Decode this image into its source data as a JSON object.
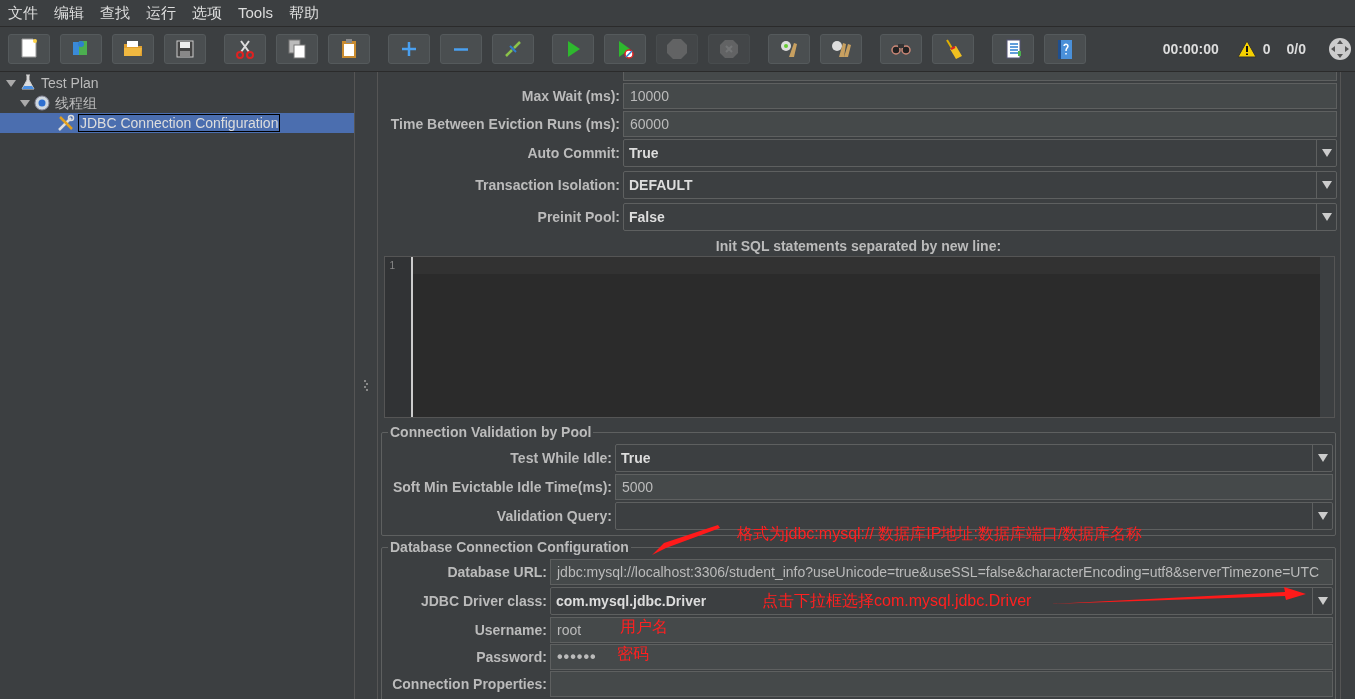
{
  "menu": [
    {
      "label": "文件"
    },
    {
      "label": "编辑"
    },
    {
      "label": "查找"
    },
    {
      "label": "运行"
    },
    {
      "label": "选项"
    },
    {
      "label": "Tools"
    },
    {
      "label": "帮助"
    }
  ],
  "toolbar": {
    "buttons": [
      {
        "disabled": false
      },
      {
        "disabled": false
      },
      {
        "disabled": false
      },
      {
        "disabled": false
      },
      {
        "disabled": false
      },
      {
        "disabled": false
      },
      {
        "disabled": false
      },
      {
        "disabled": false
      },
      {
        "disabled": false
      },
      {
        "disabled": false
      },
      {
        "disabled": false
      },
      {
        "disabled": false
      },
      {
        "disabled": true
      },
      {
        "disabled": true
      },
      {
        "disabled": false
      },
      {
        "disabled": false
      },
      {
        "disabled": false
      },
      {
        "disabled": false
      },
      {
        "disabled": false
      },
      {
        "disabled": false
      }
    ],
    "timer": "00:00:00",
    "warnings": "0",
    "threads": "0/0"
  },
  "tree": [
    {
      "label": "Test Plan",
      "kind": "test-plan",
      "selected": false,
      "expanded": true,
      "children": [
        {
          "label": "线程组",
          "kind": "thread-group",
          "selected": false,
          "expanded": true,
          "children": [
            {
              "label": "JDBC Connection Configuration",
              "kind": "config",
              "selected": true
            }
          ]
        }
      ]
    }
  ],
  "pool_fields": [
    {
      "kind": "text"
    },
    {
      "label": "Max Wait (ms):",
      "kind": "text",
      "value": "10000"
    },
    {
      "label": "Time Between Eviction Runs (ms):",
      "kind": "text",
      "value": "60000"
    },
    {
      "label": "Auto Commit:",
      "kind": "combo",
      "value": "True"
    },
    {
      "label": "Transaction Isolation:",
      "kind": "combo",
      "value": "DEFAULT"
    },
    {
      "label": "Preinit Pool:",
      "kind": "combo",
      "value": "False"
    }
  ],
  "init_sql": {
    "heading": "Init SQL statements separated by new line:",
    "line_numbers": [
      "1"
    ]
  },
  "validation": {
    "legend": "Connection Validation by Pool",
    "fields": [
      {
        "label": "Test While Idle:",
        "kind": "combo",
        "value": "True"
      },
      {
        "label": "Soft Min Evictable Idle Time(ms):",
        "kind": "text",
        "value": "5000"
      },
      {
        "label": "Validation Query:",
        "kind": "combo"
      }
    ]
  },
  "database": {
    "legend": "Database Connection Configuration",
    "fields": [
      {
        "label": "Database URL:",
        "kind": "text",
        "value": "jdbc:mysql://localhost:3306/student_info?useUnicode=true&useSSL=false&characterEncoding=utf8&serverTimezone=UTC"
      },
      {
        "label": "JDBC Driver class:",
        "kind": "combo",
        "value": "com.mysql.jdbc.Driver"
      },
      {
        "label": "Username:",
        "kind": "text",
        "value": "root"
      },
      {
        "label": "Password:",
        "kind": "password",
        "value": "••••••"
      },
      {
        "label": "Connection Properties:",
        "kind": "text"
      }
    ]
  },
  "annotations": [
    {
      "text": "格式为jdbc:mysql:// 数据库IP地址:数据库端口/数据库名称",
      "kind": "arrow-note"
    },
    {
      "text": "点击下拉框选择com.mysql.jdbc.Driver",
      "kind": "arrow-note"
    },
    {
      "text": "用户名",
      "kind": "note"
    },
    {
      "text": "密码",
      "kind": "note"
    }
  ]
}
